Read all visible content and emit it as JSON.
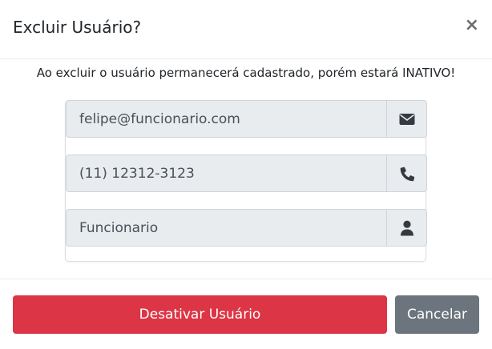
{
  "modal": {
    "title": "Excluir Usuário?",
    "close_label": "×",
    "warning": "Ao excluir o usuário permanecerá cadastrado, porém estará INATIVO!"
  },
  "fields": {
    "email": {
      "value": "felipe@funcionario.com",
      "icon": "envelope-icon"
    },
    "phone": {
      "value": "(11) 12312-3123",
      "icon": "phone-icon"
    },
    "role": {
      "value": "Funcionario",
      "icon": "user-icon"
    }
  },
  "footer": {
    "deactivate_label": "Desativar Usuário",
    "cancel_label": "Cancelar"
  },
  "colors": {
    "danger": "#dc3545",
    "secondary": "#6c757d",
    "field_bg": "#e9ecef",
    "icon": "#343a40"
  }
}
